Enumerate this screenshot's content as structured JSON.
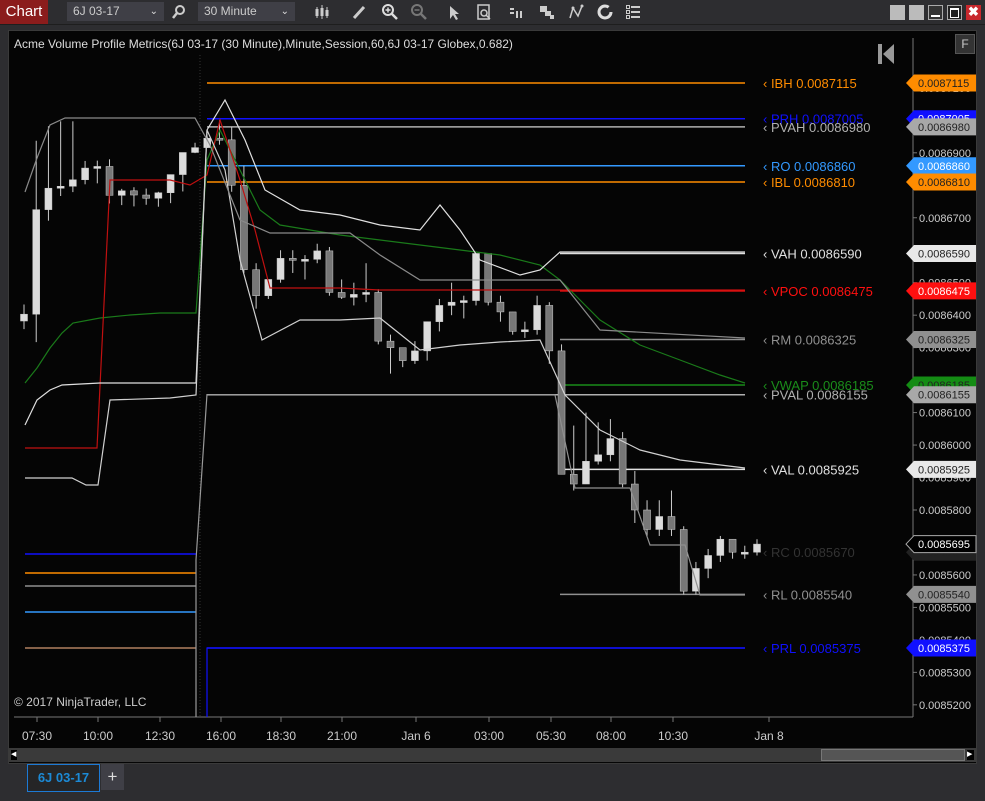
{
  "toolbar": {
    "app_label": "Chart",
    "instrument": "6J 03-17",
    "interval": "30 Minute",
    "icons": [
      "search-icon",
      "bar-type-icon",
      "draw-pencil-icon",
      "zoom-in-icon",
      "zoom-out-icon",
      "pointer-icon",
      "data-box-icon",
      "order-entry-icon",
      "properties-icon",
      "strategy-icon",
      "refresh-icon",
      "indicator-list-icon"
    ]
  },
  "window_controls": [
    "tile-button",
    "tile-button-2",
    "minimize-button",
    "maximize-button",
    "close-button"
  ],
  "chart": {
    "indicator_title": "Acme Volume Profile Metrics(6J 03-17 (30 Minute),Minute,Session,60,6J 03-17 Globex,0.682)",
    "f_button": "F",
    "copyright": "© 2017 NinjaTrader, LLC"
  },
  "tabs": [
    {
      "label": "6J 03-17",
      "active": true
    }
  ],
  "add_tab_label": "+",
  "chart_data": {
    "type": "candlestick",
    "title": "Acme Volume Profile Metrics",
    "ylim": [
      0.00851,
      0.00872
    ],
    "y_ticks": [
      "0.0085200",
      "0.0085300",
      "0.0085400",
      "0.0085500",
      "0.0085600",
      "0.0085700",
      "0.0085800",
      "0.0085900",
      "0.0086000",
      "0.0086100",
      "0.0086200",
      "0.0086300",
      "0.0086400",
      "0.0086500",
      "0.0086600",
      "0.0086700",
      "0.0086800",
      "0.0086900",
      "0.0087000",
      "0.0087100"
    ],
    "x_ticks": [
      "07:30",
      "10:00",
      "12:30",
      "16:00",
      "18:30",
      "21:00",
      "Jan 6",
      "03:00",
      "05:30",
      "08:00",
      "10:30",
      "Jan 8"
    ],
    "last_price": "0.0085695",
    "levels": [
      {
        "name": "PRH",
        "value": 0.0087005,
        "label": "PRH 0.0087005",
        "color": "#1010ff"
      },
      {
        "name": "PVAH",
        "value": 0.008698,
        "label": "PVAH 0.0086980",
        "color": "#b0b0b0"
      },
      {
        "name": "IBH",
        "value": 0.0087115,
        "label": "IBH 0.0087115",
        "color": "#ff8c00"
      },
      {
        "name": "RO",
        "value": 0.008686,
        "label": "RO 0.0086860",
        "color": "#3399ff"
      },
      {
        "name": "IBL",
        "value": 0.008681,
        "label": "IBL 0.0086810",
        "color": "#ff8c00"
      },
      {
        "name": "VAH",
        "value": 0.008659,
        "label": "VAH 0.0086590",
        "color": "#e0e0e0"
      },
      {
        "name": "VPOC",
        "value": 0.0086475,
        "label": "VPOC 0.0086475",
        "color": "#ff1010"
      },
      {
        "name": "RM",
        "value": 0.0086325,
        "label": "RM 0.0086325",
        "color": "#909090"
      },
      {
        "name": "VWAP",
        "value": 0.0086185,
        "label": "VWAP 0.0086185",
        "color": "#1a8c1a"
      },
      {
        "name": "PVAL",
        "value": 0.0086155,
        "label": "PVAL 0.0086155",
        "color": "#b0b0b0"
      },
      {
        "name": "VAL",
        "value": 0.0085925,
        "label": "VAL 0.0085925",
        "color": "#e0e0e0"
      },
      {
        "name": "RC",
        "value": 0.008567,
        "label": "RC 0.0085670",
        "color": "#303030"
      },
      {
        "name": "RL",
        "value": 0.008554,
        "label": "RL 0.0085540",
        "color": "#909090"
      },
      {
        "name": "PRL",
        "value": 0.0085375,
        "label": "PRL 0.0085375",
        "color": "#1010ff"
      }
    ],
    "candles": [
      [
        0.0086382,
        0.0086403,
        0.0086433,
        0.0086357
      ],
      [
        0.0086403,
        0.0086725,
        0.0086937,
        0.0086317
      ],
      [
        0.0086725,
        0.0086791,
        0.0086982,
        0.0086691
      ],
      [
        0.0086791,
        0.0086797,
        0.0086997,
        0.0086767
      ],
      [
        0.0086797,
        0.0086817,
        0.0086997,
        0.0086779
      ],
      [
        0.0086817,
        0.0086853,
        0.0086875,
        0.0086803
      ],
      [
        0.0086853,
        0.0086858,
        0.0086876,
        0.0086806
      ],
      [
        0.0086858,
        0.0086769,
        0.008688,
        0.0086744
      ],
      [
        0.0086769,
        0.0086783,
        0.0086789,
        0.0086739
      ],
      [
        0.0086783,
        0.008677,
        0.0086794,
        0.0086735
      ],
      [
        0.008677,
        0.008676,
        0.008679,
        0.008674
      ],
      [
        0.008676,
        0.0086777,
        0.008678,
        0.0086734
      ],
      [
        0.0086777,
        0.0086833,
        0.0086833,
        0.0086745
      ],
      [
        0.0086833,
        0.0086901,
        0.0086901,
        0.0086781
      ],
      [
        0.0086901,
        0.0086916,
        0.0086931,
        0.0086899
      ],
      [
        0.0086916,
        0.0086945,
        0.008695,
        0.0086915
      ],
      [
        0.0086945,
        0.008694,
        0.0087,
        0.0086925
      ],
      [
        0.008694,
        0.00868,
        0.008698,
        0.008678
      ],
      [
        0.00868,
        0.008654,
        0.008686,
        0.008653
      ],
      [
        0.008654,
        0.008646,
        0.008656,
        0.008642
      ],
      [
        0.008646,
        0.008651,
        0.00865,
        0.008645
      ],
      [
        0.008651,
        0.0086575,
        0.00866,
        0.00865
      ],
      [
        0.0086575,
        0.008657,
        0.00866,
        0.008653
      ],
      [
        0.008657,
        0.0086572,
        0.0086585,
        0.008651
      ],
      [
        0.0086572,
        0.0086598,
        0.008662,
        0.008656
      ],
      [
        0.0086598,
        0.008647,
        0.008661,
        0.008646
      ],
      [
        0.008647,
        0.0086455,
        0.008651,
        0.008645
      ],
      [
        0.0086455,
        0.0086464,
        0.00865,
        0.008643
      ],
      [
        0.0086464,
        0.008647,
        0.008656,
        0.008644
      ],
      [
        0.008647,
        0.008632,
        0.008648,
        0.008631
      ],
      [
        0.008632,
        0.00863,
        0.008634,
        0.008622
      ],
      [
        0.00863,
        0.008626,
        0.008627,
        0.008624
      ],
      [
        0.008626,
        0.008629,
        0.008632,
        0.008625
      ],
      [
        0.008629,
        0.008638,
        0.008638,
        0.008626
      ],
      [
        0.008638,
        0.008643,
        0.008645,
        0.008635
      ],
      [
        0.008643,
        0.008644,
        0.00865,
        0.00864
      ],
      [
        0.008644,
        0.0086445,
        0.008646,
        0.008639
      ],
      [
        0.0086445,
        0.008659,
        0.008659,
        0.008643
      ],
      [
        0.008659,
        0.008644,
        0.008659,
        0.008643
      ],
      [
        0.008644,
        0.008641,
        0.008646,
        0.008638
      ],
      [
        0.008641,
        0.008635,
        0.008641,
        0.008634
      ],
      [
        0.008635,
        0.0086355,
        0.008638,
        0.008633
      ],
      [
        0.0086355,
        0.008643,
        0.008646,
        0.008634
      ],
      [
        0.008643,
        0.008629,
        0.008644,
        0.008625
      ],
      [
        0.008629,
        0.008591,
        0.008631,
        0.008591
      ],
      [
        0.008591,
        0.008588,
        0.008606,
        0.008586
      ],
      [
        0.008588,
        0.008595,
        0.00861,
        0.008588
      ],
      [
        0.008595,
        0.008597,
        0.008607,
        0.008594
      ],
      [
        0.008597,
        0.008602,
        0.008608,
        0.008595
      ],
      [
        0.008602,
        0.008588,
        0.008604,
        0.008587
      ],
      [
        0.008588,
        0.00858,
        0.008592,
        0.008576
      ],
      [
        0.00858,
        0.008574,
        0.008583,
        0.008572
      ],
      [
        0.008574,
        0.008578,
        0.008583,
        0.008572
      ],
      [
        0.008578,
        0.008574,
        0.008586,
        0.008572
      ],
      [
        0.008574,
        0.008555,
        0.008575,
        0.008554
      ],
      [
        0.008555,
        0.008562,
        0.008564,
        0.008554
      ],
      [
        0.008562,
        0.008566,
        0.008568,
        0.008559
      ],
      [
        0.008566,
        0.008571,
        0.008572,
        0.008564
      ],
      [
        0.008571,
        0.008567,
        0.008571,
        0.008565
      ],
      [
        0.008567,
        0.008567,
        0.008569,
        0.008565
      ],
      [
        0.008567,
        0.0085695,
        0.008571,
        0.008566
      ]
    ]
  }
}
